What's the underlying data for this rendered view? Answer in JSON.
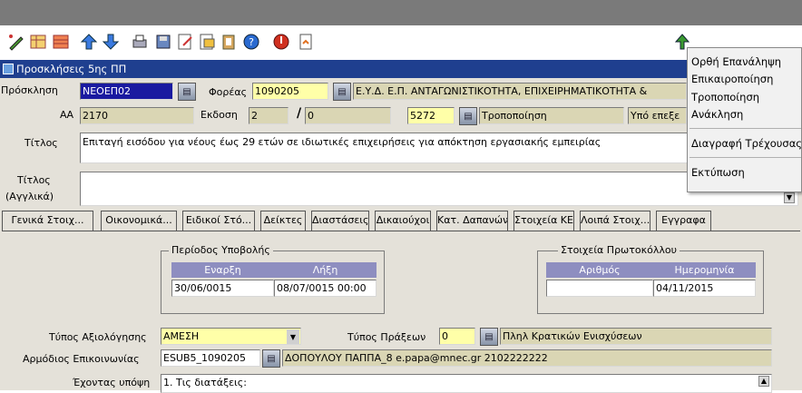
{
  "window": {
    "title": "Προσκλήσεις 5ης ΠΠ"
  },
  "toolbar": {
    "icons": [
      "edit-icon",
      "grid-icon",
      "table-icon",
      "up-arrow-icon",
      "down-arrow-icon",
      "print-icon",
      "save-icon",
      "notes-icon",
      "export-icon",
      "clipboard-icon",
      "help-icon",
      "exit-icon",
      "report-icon"
    ]
  },
  "context_menu": {
    "items": [
      "Ορθή Επανάληψη",
      "Επικαιροποίηση",
      "Τροποποίηση",
      "Ανάκληση",
      "Διαγραφή Τρέχουσας",
      "Εκτύπωση"
    ]
  },
  "form": {
    "proskl_label": "Πρόσκληση",
    "proskl_value": "ΝΕΟΕΠ02",
    "foreas_label": "Φορέας",
    "foreas_code": "1090205",
    "foreas_name": "Ε.Υ.Δ. Ε.Π. ΑΝΤΑΓΩΝΙΣΤΙΚΟΤΗΤΑ, ΕΠΙΧΕΙΡΗΜΑΤΙΚΟΤΗΤΑ &",
    "aa_label": "ΑΑ",
    "aa_value": "2170",
    "ekdosi_label": "Εκδοση",
    "ekdosi_value": "2",
    "ekdosi_slash": "/",
    "ekdosi_sub": "0",
    "status_code": "5272",
    "status_text": "Τροποποίηση",
    "status_right": "Υπό επεξε",
    "titlos_label": "Τίτλος",
    "titlos_value": "Επιταγή εισόδου για νέους έως 29 ετών σε ιδιωτικές επιχειρήσεις για απόκτηση εργασιακής εμπειρίας",
    "titlos_en_label_1": "Τίτλος",
    "titlos_en_label_2": "(Αγγλικά)",
    "titlos_en_value": ""
  },
  "tabs": [
    "Γενικά Στοιχ...",
    "Οικονομικά...",
    "Ειδικοί Στό...",
    "Δείκτες",
    "Διαστάσεις",
    "Δικαιούχοι",
    "Κατ. Δαπανών",
    "Στοιχεία ΚΕ",
    "Λοιπά Στοιχ...",
    "Εγγραφα"
  ],
  "general": {
    "period_title": "Περίοδος Υποβολής",
    "start_hdr": "Εναρξη",
    "end_hdr": "Λήξη",
    "start_value": "30/06/0015",
    "end_value": "08/07/0015 00:00",
    "protocol_title": "Στοιχεία Πρωτοκόλλου",
    "number_hdr": "Αριθμός",
    "date_hdr": "Ημερομηνία",
    "number_value": "",
    "date_value": "04/11/2015",
    "axiol_label": "Τύπος Αξιολόγησης",
    "axiol_value": "ΑΜΕΣΗ",
    "praxeon_label": "Τύπος Πράξεων",
    "praxeon_code": "0",
    "praxeon_text": "Πληλ Κρατικών Ενισχύσεων",
    "armod_label": "Αρμόδιος Επικοινωνίας",
    "armod_code": "ESUB5_1090205",
    "armod_text": "ΔΟΠΟΥΛΟΥ ΠΑΠΠΑ_8 e.papa@mnec.gr 2102222222",
    "exontas_label": "Έχοντας υπόψη",
    "exontas_value": "1. Τις διατάξεις:"
  }
}
